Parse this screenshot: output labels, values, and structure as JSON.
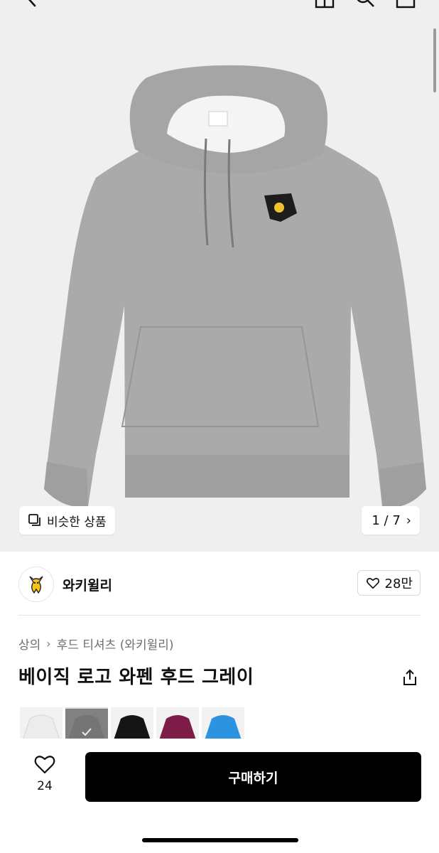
{
  "gallery": {
    "similar_label": "비슷한 상품",
    "counter": "1 / 7"
  },
  "shop": {
    "name": "와키윌리",
    "likes": "28만"
  },
  "breadcrumb": {
    "category": "상의",
    "subcategory": "후드 티셔츠 (와키윌리)"
  },
  "product": {
    "title": "베이직 로고 와펜 후드 그레이"
  },
  "swatches": [
    {
      "color": "#ececec",
      "selected": false
    },
    {
      "color": "#7f7f7f",
      "selected": true
    },
    {
      "color": "#151515",
      "selected": false
    },
    {
      "color": "#7d1d47",
      "selected": false
    },
    {
      "color": "#2b93e0",
      "selected": false
    }
  ],
  "bottom": {
    "wish_count": "24",
    "buy_label": "구매하기"
  },
  "colors": {
    "hoodie": "#a9a9a9",
    "background": "#efefef",
    "accent": "#000000"
  }
}
